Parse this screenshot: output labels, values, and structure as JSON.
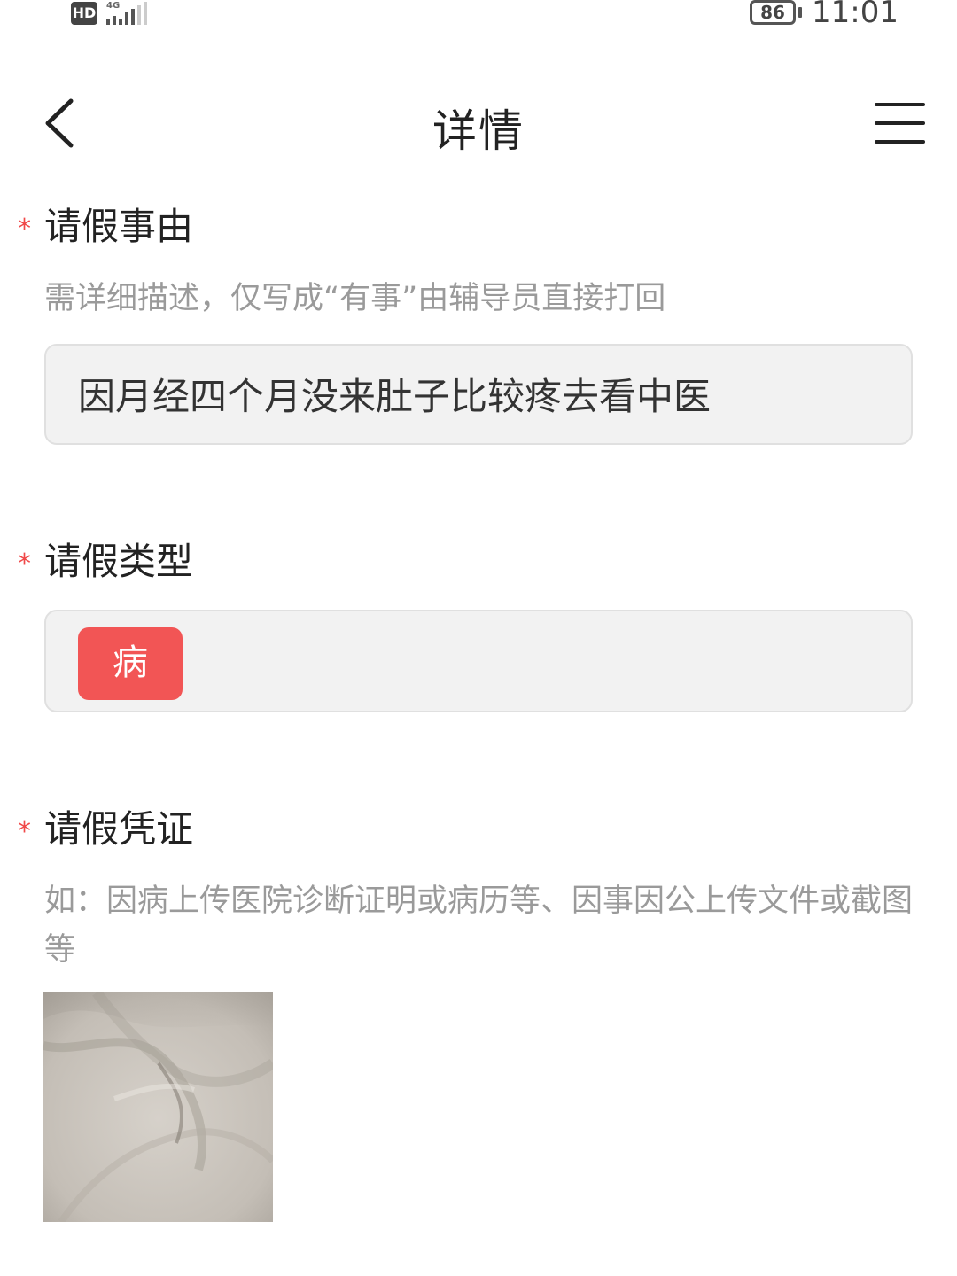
{
  "status_bar": {
    "hd_label": "HD",
    "network_label": "4G",
    "battery_level": "86",
    "time": "11:01"
  },
  "nav": {
    "title": "详情",
    "back_icon": "chevron-left-icon",
    "menu_icon": "hamburger-menu-icon"
  },
  "reason_section": {
    "required_mark": "*",
    "label": "请假事由",
    "hint": "需详细描述，仅写成“有事”由辅导员直接打回",
    "value": "因月经四个月没来肚子比较疼去看中医"
  },
  "type_section": {
    "required_mark": "*",
    "label": "请假类型",
    "selected_type": "病"
  },
  "proof_section": {
    "required_mark": "*",
    "label": "请假凭证",
    "hint": "如：因病上传医院诊断证明或病历等、因事因公上传文件或截图等"
  },
  "colors": {
    "accent": "#f25555",
    "required": "#f04848",
    "field_bg": "#f2f2f2",
    "hint_text": "#9a9a9a"
  }
}
